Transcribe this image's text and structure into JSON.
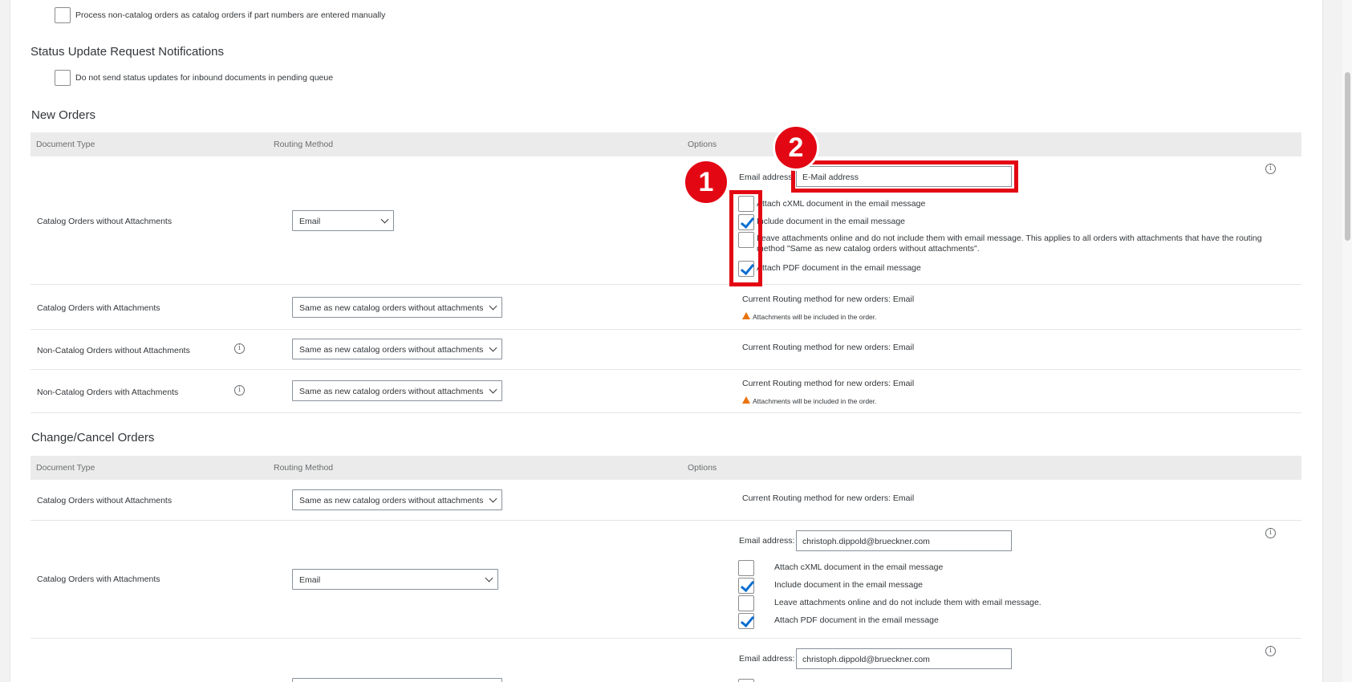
{
  "top_option": {
    "label": "Process non-catalog orders as catalog orders if part numbers are entered manually"
  },
  "status_section": {
    "title": "Status Update Request Notifications",
    "option_label": "Do not send status updates for inbound documents in pending queue"
  },
  "new_orders": {
    "title": "New Orders",
    "headers": {
      "doc_type": "Document Type",
      "routing": "Routing Method",
      "options": "Options"
    },
    "row1": {
      "doc_type": "Catalog Orders without Attachments",
      "routing": "Email",
      "email_label": "Email address:",
      "email_placeholder": "E-Mail address",
      "opt_cxml": "Attach cXML document in the email message",
      "opt_include": "Include document in the email message",
      "opt_leave": "Leave attachments online and do not include them with email message.  This applies to all orders with attachments that have the routing method \"Same as new catalog orders without attachments\".",
      "opt_pdf": "Attach PDF document in the email message"
    },
    "row2": {
      "doc_type": "Catalog Orders with Attachments",
      "routing": "Same as new catalog orders without attachments",
      "current": "Current Routing method for new orders:  Email",
      "warning": "Attachments will be included in the order."
    },
    "row3": {
      "doc_type": "Non-Catalog Orders without Attachments",
      "routing": "Same as new catalog orders without attachments",
      "current": "Current Routing method for new orders:  Email"
    },
    "row4": {
      "doc_type": "Non-Catalog Orders with Attachments",
      "routing": "Same as new catalog orders without attachments",
      "current": "Current Routing method for new orders:  Email",
      "warning": "Attachments will be included in the order."
    }
  },
  "change_orders": {
    "title": "Change/Cancel Orders",
    "headers": {
      "doc_type": "Document Type",
      "routing": "Routing Method",
      "options": "Options"
    },
    "row1": {
      "doc_type": "Catalog Orders without Attachments",
      "routing": "Same as new catalog orders without attachments",
      "current": "Current Routing method for new orders:  Email"
    },
    "row2": {
      "doc_type": "Catalog Orders with Attachments",
      "routing": "Email",
      "email_label": "Email address:",
      "email_value": "christoph.dippold@brueckner.com",
      "opt_cxml": "Attach cXML document in the email message",
      "opt_include": "Include document in the email message",
      "opt_leave": "Leave attachments online and do not include them with email message.",
      "opt_pdf": "Attach PDF document in the email message"
    },
    "row3": {
      "email_label": "Email address:",
      "email_value": "christoph.dippold@brueckner.com"
    }
  },
  "annotations": {
    "badge1": "1",
    "badge2": "2"
  },
  "colors": {
    "highlight": "#e30613",
    "check": "#0a6ed1",
    "warning": "#e9730c"
  }
}
